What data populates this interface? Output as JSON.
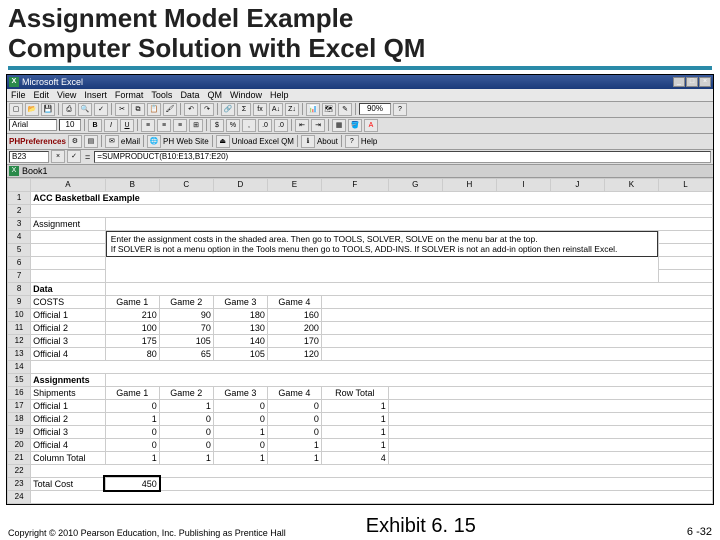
{
  "slide": {
    "title_line1": "Assignment Model Example",
    "title_line2": "Computer Solution with Excel QM",
    "copyright": "Copyright © 2010 Pearson Education, Inc. Publishing as Prentice Hall",
    "exhibit": "Exhibit 6. 15",
    "pagenum": "6 -32"
  },
  "excel": {
    "app_title": "Microsoft Excel",
    "menus": [
      "File",
      "Edit",
      "View",
      "Insert",
      "Format",
      "Tools",
      "Data",
      "QM",
      "Window",
      "Help"
    ],
    "zoom": "90%",
    "font_name": "Arial",
    "font_size": "10",
    "qm_toolbar": {
      "pref": "PHPreferences",
      "email": "eMail",
      "site": "PH Web Site",
      "unload": "Unload Excel QM",
      "about": "About",
      "help": "Help"
    },
    "cell_ref": "B23",
    "formula": "=SUMPRODUCT(B10:E13,B17:E20)",
    "book": "Book1",
    "columns": [
      "A",
      "B",
      "C",
      "D",
      "E",
      "F",
      "G",
      "H",
      "I",
      "J",
      "K",
      "L"
    ],
    "rows": {
      "1": {
        "A_bold": "ACC Basketball Example"
      },
      "3": {
        "A": "Assignment"
      },
      "instr1": "Enter the assignment costs in the shaded area. Then go to TOOLS, SOLVER, SOLVE on the menu bar at the top.",
      "instr2": "If SOLVER is not a menu option in the Tools menu then go to TOOLS, ADD-INS. If SOLVER is not an add-in option then reinstall Excel.",
      "8": {
        "A": "Data"
      },
      "9": {
        "A": "COSTS",
        "B": "Game 1",
        "C": "Game 2",
        "D": "Game 3",
        "E": "Game 4"
      },
      "10": {
        "A": "Official 1",
        "B": "210",
        "C": "90",
        "D": "180",
        "E": "160"
      },
      "11": {
        "A": "Official 2",
        "B": "100",
        "C": "70",
        "D": "130",
        "E": "200"
      },
      "12": {
        "A": "Official 3",
        "B": "175",
        "C": "105",
        "D": "140",
        "E": "170"
      },
      "13": {
        "A": "Official 4",
        "B": "80",
        "C": "65",
        "D": "105",
        "E": "120"
      },
      "15": {
        "A_bold": "Assignments"
      },
      "16": {
        "A": "Shipments",
        "B": "Game 1",
        "C": "Game 2",
        "D": "Game 3",
        "E": "Game 4",
        "F": "Row Total"
      },
      "17": {
        "A": "Official 1",
        "B": "0",
        "C": "1",
        "D": "0",
        "E": "0",
        "F": "1"
      },
      "18": {
        "A": "Official 2",
        "B": "1",
        "C": "0",
        "D": "0",
        "E": "0",
        "F": "1"
      },
      "19": {
        "A": "Official 3",
        "B": "0",
        "C": "0",
        "D": "1",
        "E": "0",
        "F": "1"
      },
      "20": {
        "A": "Official 4",
        "B": "0",
        "C": "0",
        "D": "0",
        "E": "1",
        "F": "1"
      },
      "21": {
        "A": "Column Total",
        "B": "1",
        "C": "1",
        "D": "1",
        "E": "1",
        "F": "4"
      },
      "23": {
        "A": "Total Cost",
        "B": "450"
      }
    }
  },
  "chart_data": {
    "type": "table",
    "title": "ACC Basketball Example — Assignment Model",
    "costs": {
      "columns": [
        "Game 1",
        "Game 2",
        "Game 3",
        "Game 4"
      ],
      "rows": [
        "Official 1",
        "Official 2",
        "Official 3",
        "Official 4"
      ],
      "values": [
        [
          210,
          90,
          180,
          160
        ],
        [
          100,
          70,
          130,
          200
        ],
        [
          175,
          105,
          140,
          170
        ],
        [
          80,
          65,
          105,
          120
        ]
      ]
    },
    "assignments": {
      "columns": [
        "Game 1",
        "Game 2",
        "Game 3",
        "Game 4",
        "Row Total"
      ],
      "rows": [
        "Official 1",
        "Official 2",
        "Official 3",
        "Official 4",
        "Column Total"
      ],
      "values": [
        [
          0,
          1,
          0,
          0,
          1
        ],
        [
          1,
          0,
          0,
          0,
          1
        ],
        [
          0,
          0,
          1,
          0,
          1
        ],
        [
          0,
          0,
          0,
          1,
          1
        ],
        [
          1,
          1,
          1,
          1,
          4
        ]
      ]
    },
    "total_cost": 450
  }
}
